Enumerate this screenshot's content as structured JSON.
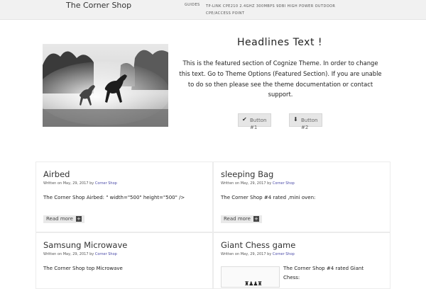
{
  "header": {
    "logo": "The Corner Shop",
    "nav": {
      "guides": "GUIDES",
      "product": "TP-LINK CPE210 2.4GHZ 300MBPS 9DBI HIGH POWER OUTDOOR CPE/ACCESS POINT"
    }
  },
  "featured": {
    "headline": "Headlines Text !",
    "text": "This is the featured section of Cognize Theme. In order to change this text. Go to Theme Options (Featured Section). If you are unable to do so then please see the theme documentation or contact support.",
    "button1": "Button #1",
    "button2": "Button #2",
    "image_alt": "horses running in dust"
  },
  "posts": [
    {
      "title": "Airbed",
      "meta_prefix": "Written on May, 29, 2017 by",
      "author": "Corner Shop",
      "excerpt": "The Corner Shop Airbed:    \" width=\"500\" height=\"500\" />",
      "read_more": "Read more"
    },
    {
      "title": "sleeping Bag",
      "meta_prefix": "Written on May, 29, 2017 by",
      "author": "Corner Shop",
      "excerpt": "The Corner Shop #4 rated ,mini oven:",
      "read_more": "Read more"
    },
    {
      "title": "Samsung Microwave",
      "meta_prefix": "Written on May, 29, 2017 by",
      "author": "Corner Shop",
      "excerpt": "The Corner Shop top Microwave"
    },
    {
      "title": "Giant Chess game",
      "meta_prefix": "Written on May, 29, 2017 by",
      "author": "Corner Shop",
      "excerpt_line1": "The Corner Shop #4 rated Giant",
      "excerpt_line2": "Chess:"
    }
  ],
  "colors": {
    "author_link": "#4a4aa8",
    "topbar_bg": "#f1f1f1"
  }
}
